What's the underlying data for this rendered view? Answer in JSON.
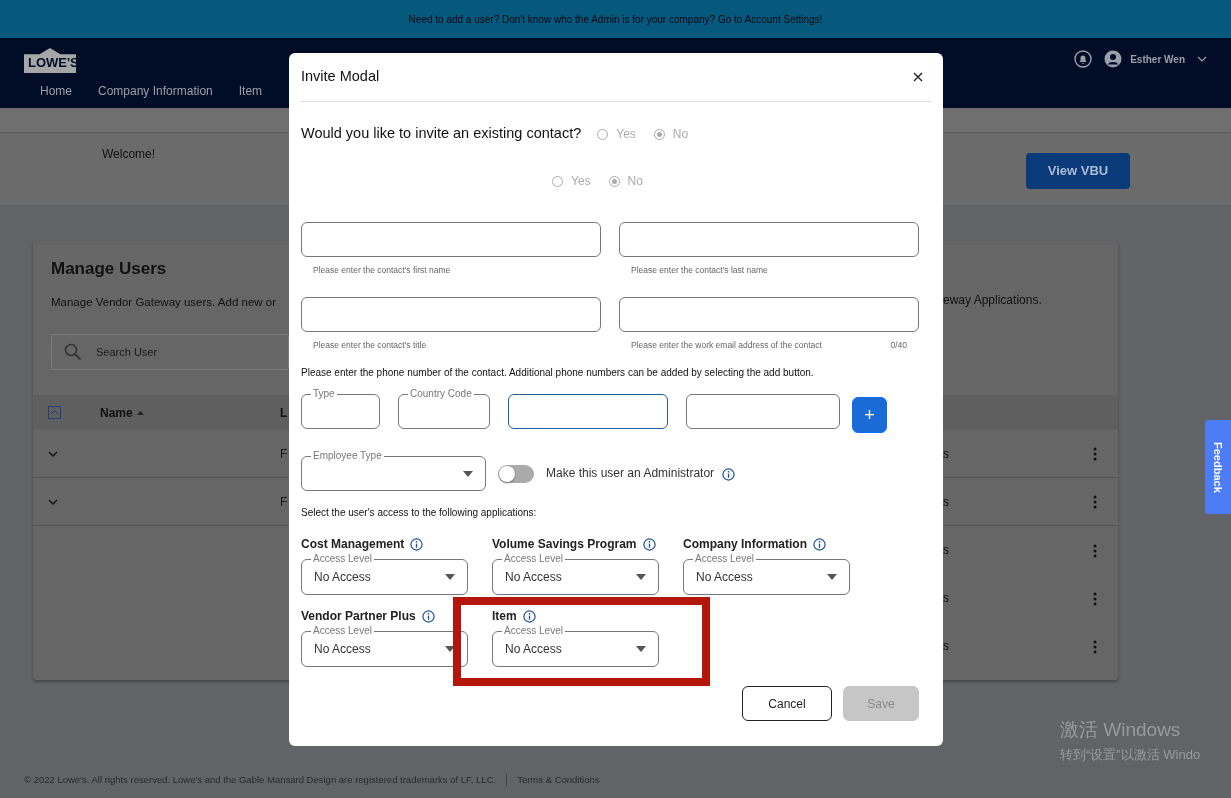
{
  "banner": {
    "text": "Need to add a user? Don't know who the Admin is for your company? Go to Account Settings!"
  },
  "header": {
    "logo": "LOWE'S",
    "nav": [
      {
        "label": "Home"
      },
      {
        "label": "Company Information"
      },
      {
        "label": "Item"
      }
    ],
    "user": "Esther Wen"
  },
  "welcome": {
    "text": "Welcome!",
    "button": "View VBU"
  },
  "manage_users": {
    "title": "Manage Users",
    "description_left": "Manage Vendor Gateway users. Add new or",
    "description_right": "eway Applications.",
    "search": {
      "placeholder": "Search User"
    },
    "columns": [
      {
        "label": "Name",
        "sorted": true
      },
      {
        "label": "L"
      }
    ],
    "rows": [
      {
        "column_2": "F",
        "column_3": "s"
      },
      {
        "column_2": "F",
        "column_3": "s"
      },
      {
        "column_3": "s"
      },
      {
        "column_3": "s"
      },
      {
        "column_3": "s"
      }
    ]
  },
  "modal": {
    "title": "Invite Modal",
    "questions": [
      {
        "text": "Would you like to invite an existing contact?",
        "options": [
          {
            "label": "Yes",
            "selected": false
          },
          {
            "label": "No",
            "selected": true
          }
        ]
      },
      {
        "options": [
          {
            "label": "Yes",
            "selected": false
          },
          {
            "label": "No",
            "selected": true
          }
        ]
      }
    ],
    "fields": [
      {
        "helper": "Please enter the contact's first name"
      },
      {
        "helper": "Please enter the contact's last name"
      },
      {
        "helper": "Please enter the contact's title"
      },
      {
        "helper": "Please enter the work email address of the contact",
        "counter": "0/40"
      }
    ],
    "phone_instruction": "Please enter the phone number of the contact. Additional phone numbers can be added by selecting the add button.",
    "phone_fields": [
      {
        "kind": "select",
        "label": "Type"
      },
      {
        "kind": "select",
        "label": "Country Code"
      },
      {
        "kind": "input",
        "focused": true
      },
      {
        "kind": "input",
        "focused": false
      }
    ],
    "add_button": "+",
    "employee_type": {
      "label": "Employee Type"
    },
    "admin_toggle": {
      "label": "Make this user an Administrator",
      "on": false
    },
    "access_instruction": "Select the user's access to the following applications:",
    "applications": [
      {
        "name": "Cost Management",
        "legend": "Access Level",
        "value": "No Access"
      },
      {
        "name": "Volume Savings Program",
        "legend": "Access Level",
        "value": "No Access"
      },
      {
        "name": "Company Information",
        "legend": "Access Level",
        "value": "No Access"
      },
      {
        "name": "Vendor Partner Plus",
        "legend": "Access Level",
        "value": "No Access"
      },
      {
        "name": "Item",
        "legend": "Access Level",
        "value": "No Access"
      }
    ],
    "buttons": [
      {
        "label": "Cancel",
        "disabled": false
      },
      {
        "label": "Save",
        "disabled": true
      }
    ]
  },
  "footer": {
    "copyright": "© 2022 Lowe's. All rights reserved. Lowe's and the Gable Mansard Design are registered trademarks of LF, LLC.",
    "link": "Terms & Conditions"
  },
  "feedback_tab": "Feedback",
  "os_notice": {
    "title": "激活 Windows",
    "text": "转到“设置”以激活 Windo"
  }
}
